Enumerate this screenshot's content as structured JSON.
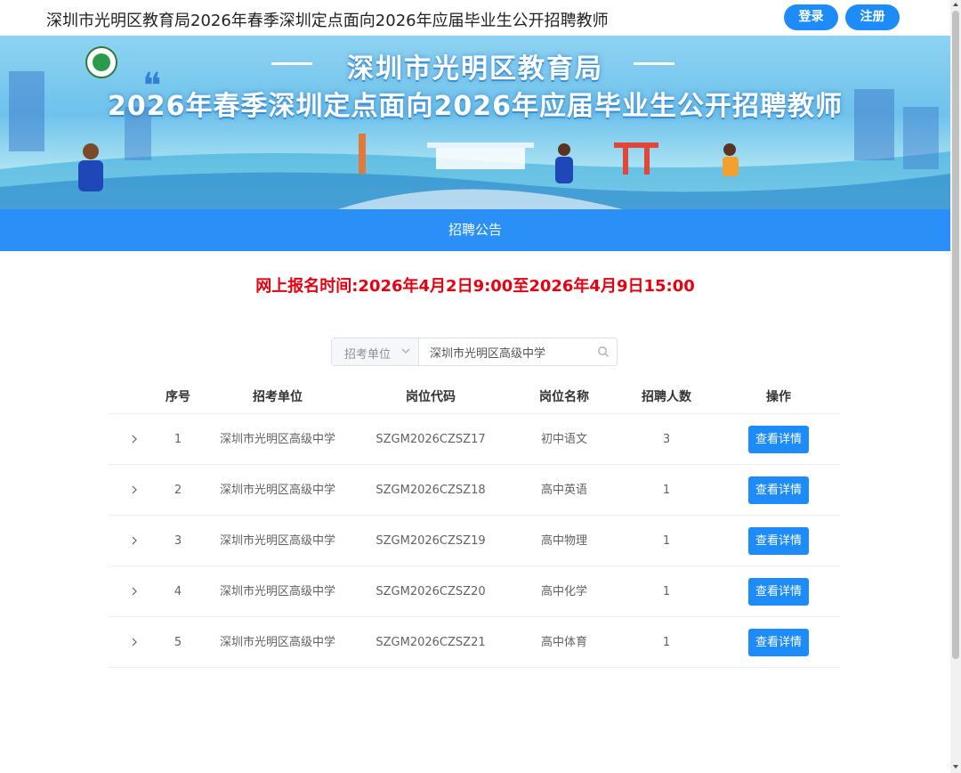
{
  "header": {
    "title": "深圳市光明区教育局2026年春季深圳定点面向2026年应届毕业生公开招聘教师",
    "login_label": "登录",
    "register_label": "注册"
  },
  "banner": {
    "line1": "深圳市光明区教育局",
    "line2": "2026年春季深圳定点面向2026年应届毕业生公开招聘教师"
  },
  "nav": {
    "items": [
      {
        "label": "招聘公告"
      }
    ]
  },
  "notice": {
    "registration_time": "网上报名时间:2026年4月2日9:00至2026年4月9日15:00"
  },
  "search": {
    "select_label": "招考单位",
    "value": "深圳市光明区高级中学"
  },
  "table": {
    "headers": {
      "no": "序号",
      "unit": "招考单位",
      "code": "岗位代码",
      "name": "岗位名称",
      "count": "招聘人数",
      "op": "操作"
    },
    "rows": [
      {
        "no": "1",
        "unit": "深圳市光明区高级中学",
        "code": "SZGM2026CZSZ17",
        "name": "初中语文",
        "count": "3",
        "op": "查看详情"
      },
      {
        "no": "2",
        "unit": "深圳市光明区高级中学",
        "code": "SZGM2026CZSZ18",
        "name": "高中英语",
        "count": "1",
        "op": "查看详情"
      },
      {
        "no": "3",
        "unit": "深圳市光明区高级中学",
        "code": "SZGM2026CZSZ19",
        "name": "高中物理",
        "count": "1",
        "op": "查看详情"
      },
      {
        "no": "4",
        "unit": "深圳市光明区高级中学",
        "code": "SZGM2026CZSZ20",
        "name": "高中化学",
        "count": "1",
        "op": "查看详情"
      },
      {
        "no": "5",
        "unit": "深圳市光明区高级中学",
        "code": "SZGM2026CZSZ21",
        "name": "高中体育",
        "count": "1",
        "op": "查看详情"
      }
    ]
  },
  "colors": {
    "primary": "#1e8cf8",
    "nav": "#2a8ff7",
    "notice": "#e60012"
  }
}
